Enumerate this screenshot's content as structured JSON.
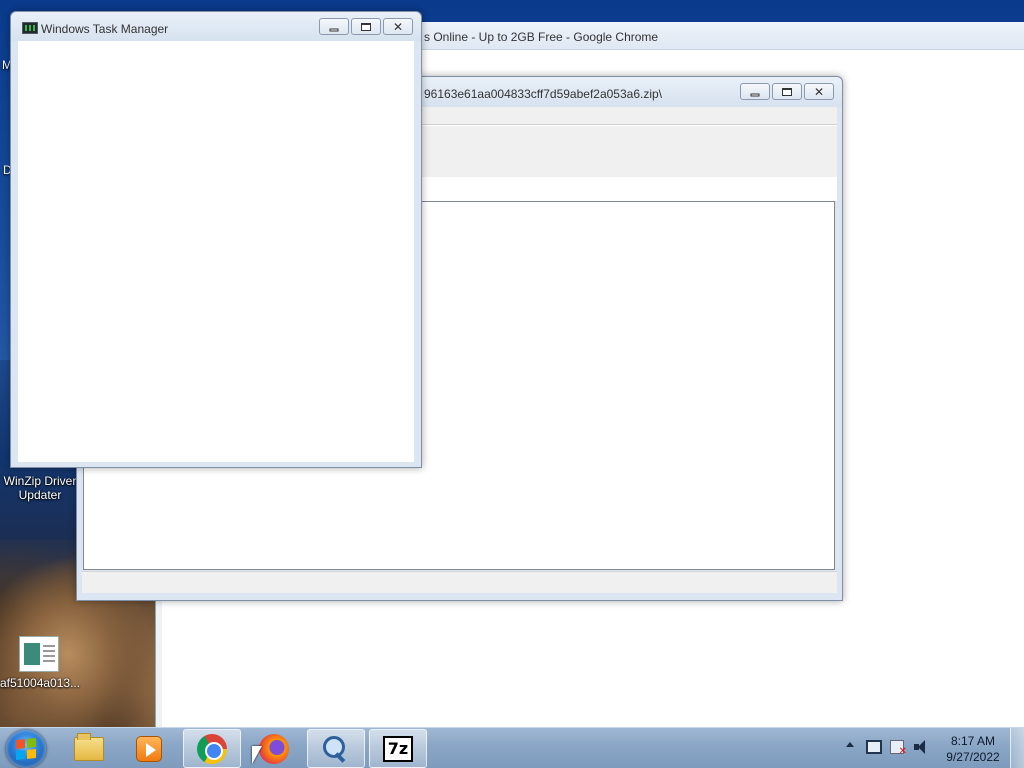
{
  "desktop": {
    "icons": [
      {
        "label": "WinZip Driver Updater"
      },
      {
        "label": "af51004a013..."
      }
    ],
    "partial_labels": [
      "M",
      "D"
    ]
  },
  "chrome_window": {
    "title": "s Online - Up to 2GB Free - Google Chrome"
  },
  "zip_window": {
    "title": "96163e61aa004833cff7d59abef2a053a6.zip\\"
  },
  "task_manager": {
    "title": "Windows Task Manager"
  },
  "caption_buttons": {
    "minimize_icon": "minimize-icon",
    "maximize_icon": "maximize-icon",
    "close_glyph": "✕"
  },
  "taskbar": {
    "pinned": [
      {
        "name": "Windows Explorer",
        "icon": "folder-icon"
      },
      {
        "name": "Windows Media Player",
        "icon": "media-player-icon"
      },
      {
        "name": "Google Chrome",
        "icon": "chrome-icon",
        "active": true
      },
      {
        "name": "Firefox",
        "icon": "firefox-icon"
      },
      {
        "name": "Search",
        "icon": "search-icon",
        "active": true
      },
      {
        "name": "7-Zip",
        "icon": "7zip-icon",
        "label": "7z",
        "active": true
      }
    ],
    "clock": {
      "time": "8:17 AM",
      "date": "9/27/2022"
    }
  },
  "colors": {
    "taskbar": "#8aa6c6",
    "window_frame": "#dbe6f2",
    "desktop": "#1b4fa0"
  }
}
